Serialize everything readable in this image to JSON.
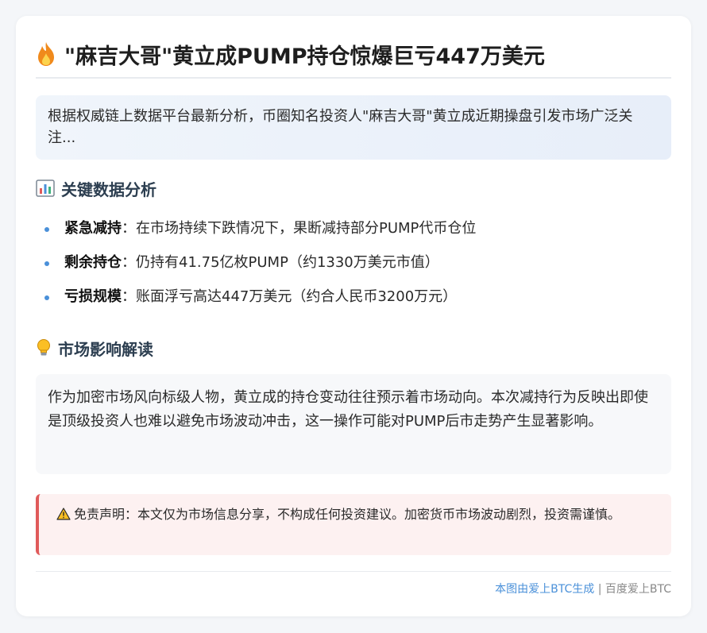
{
  "title": "\"麻吉大哥\"黄立成PUMP持仓惊爆巨亏447万美元",
  "title_icon": "fire-icon",
  "intro": "根据权威链上数据平台最新分析，币圈知名投资人\"麻吉大哥\"黄立成近期操盘引发市场广泛关注...",
  "section1": {
    "icon": "chart-icon",
    "heading": "关键数据分析",
    "items": [
      {
        "label": "紧急减持",
        "sep": "：",
        "text": "在市场持续下跌情况下，果断减持部分PUMP代币仓位"
      },
      {
        "label": "剩余持仓",
        "sep": "：",
        "text": "仍持有41.75亿枚PUMP（约1330万美元市值）"
      },
      {
        "label": "亏损规模",
        "sep": "：",
        "text": "账面浮亏高达447万美元（约合人民币3200万元）"
      }
    ]
  },
  "section2": {
    "icon": "lightbulb-icon",
    "heading": "市场影响解读",
    "body": "作为加密市场风向标级人物，黄立成的持仓变动往往预示着市场动向。本次减持行为反映出即使是顶级投资人也难以避免市场波动冲击，这一操作可能对PUMP后市走势产生显著影响。"
  },
  "disclaimer": {
    "icon": "warning-icon",
    "text": "免责声明：本文仅为市场信息分享，不构成任何投资建议。加密货币市场波动剧烈，投资需谨慎。"
  },
  "footer": {
    "link_text": "本图由爱上BTC生成",
    "separator": " | ",
    "source": "百度爱上BTC"
  },
  "colors": {
    "accent": "#4a90d9",
    "warning_border": "#e05a5a",
    "heading": "#2c3e50"
  }
}
